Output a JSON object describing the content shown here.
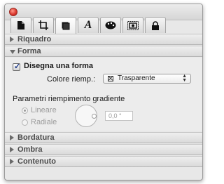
{
  "window": {
    "tabs": [
      {
        "icon": "document-icon"
      },
      {
        "icon": "crop-frame-icon"
      },
      {
        "icon": "shape-icon",
        "active": true
      },
      {
        "icon": "text-icon"
      },
      {
        "icon": "color-palette-icon"
      },
      {
        "icon": "image-frame-icon"
      },
      {
        "icon": "lock-icon"
      }
    ]
  },
  "sections": {
    "riquadro": "Riquadro",
    "forma": "Forma",
    "bordatura": "Bordatura",
    "ombra": "Ombra",
    "contenuto": "Contenuto"
  },
  "forma": {
    "draw_shape_label": "Disegna una forma",
    "draw_shape_checked": true,
    "fill_color_label": "Colore riemp.:",
    "fill_color_value": "Trasparente",
    "gradient_title": "Parametri riempimento gradiente",
    "linear_label": "Lineare",
    "radial_label": "Radiale",
    "angle_value": "0,0 °"
  },
  "colors": {
    "accent_check": "#1e3a8a",
    "close_button": "#d9342b"
  }
}
